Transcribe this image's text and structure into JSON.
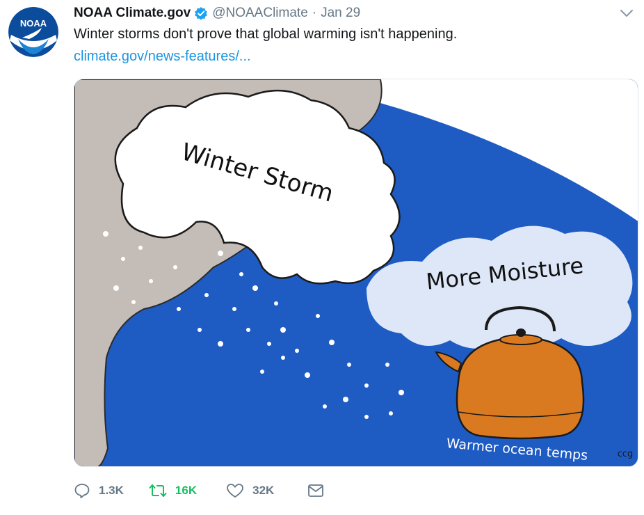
{
  "account": {
    "display_name": "NOAA Climate.gov",
    "handle": "@NOAAClimate",
    "separator": "·",
    "date": "Jan 29",
    "verified": true,
    "avatar_text": "NOAA"
  },
  "tweet": {
    "text": "Winter storms don't prove that global warming isn't happening.",
    "link": "climate.gov/news-features/..."
  },
  "media": {
    "labels": {
      "storm": "Winter Storm",
      "moisture": "More Moisture",
      "ocean": "Warmer ocean temps",
      "signature": "ccg"
    }
  },
  "actions": {
    "replies": "1.3K",
    "retweets": "16K",
    "likes": "32K"
  },
  "colors": {
    "verified_blue": "#1da1f2",
    "link_blue": "#1b95e0",
    "retweet_green": "#17bf63",
    "muted_gray": "#657786",
    "ocean_blue": "#1e5cc4",
    "land_gray": "#c4bcb6",
    "kettle_orange": "#d97a21"
  },
  "icons": {
    "reply": "reply-icon",
    "retweet": "retweet-icon",
    "like": "heart-icon",
    "dm": "envelope-icon",
    "menu": "chevron-down-icon",
    "verified": "verified-badge-icon"
  }
}
